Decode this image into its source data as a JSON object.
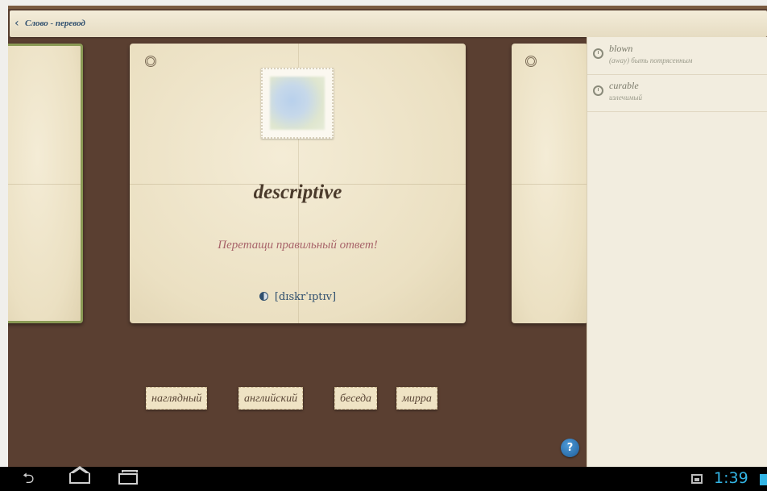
{
  "header": {
    "title": "Слово - перевод"
  },
  "card": {
    "word": "descriptive",
    "hint": "Перетащи правильный ответ!",
    "transcription": "[dɪskrˈɪptɪv]"
  },
  "answers": [
    {
      "label": "наглядный"
    },
    {
      "label": "английский"
    },
    {
      "label": "беседа"
    },
    {
      "label": "мирра"
    }
  ],
  "help_label": "?",
  "history": [
    {
      "word": "blown",
      "translation": "(away) быть потрясенным"
    },
    {
      "word": "curable",
      "translation": "излечимый"
    }
  ],
  "status": {
    "time": "1:39"
  },
  "colors": {
    "background": "#5a3f31",
    "accent_text": "#2f4f6e",
    "hint": "#a8646a",
    "clock": "#33b5e5"
  }
}
